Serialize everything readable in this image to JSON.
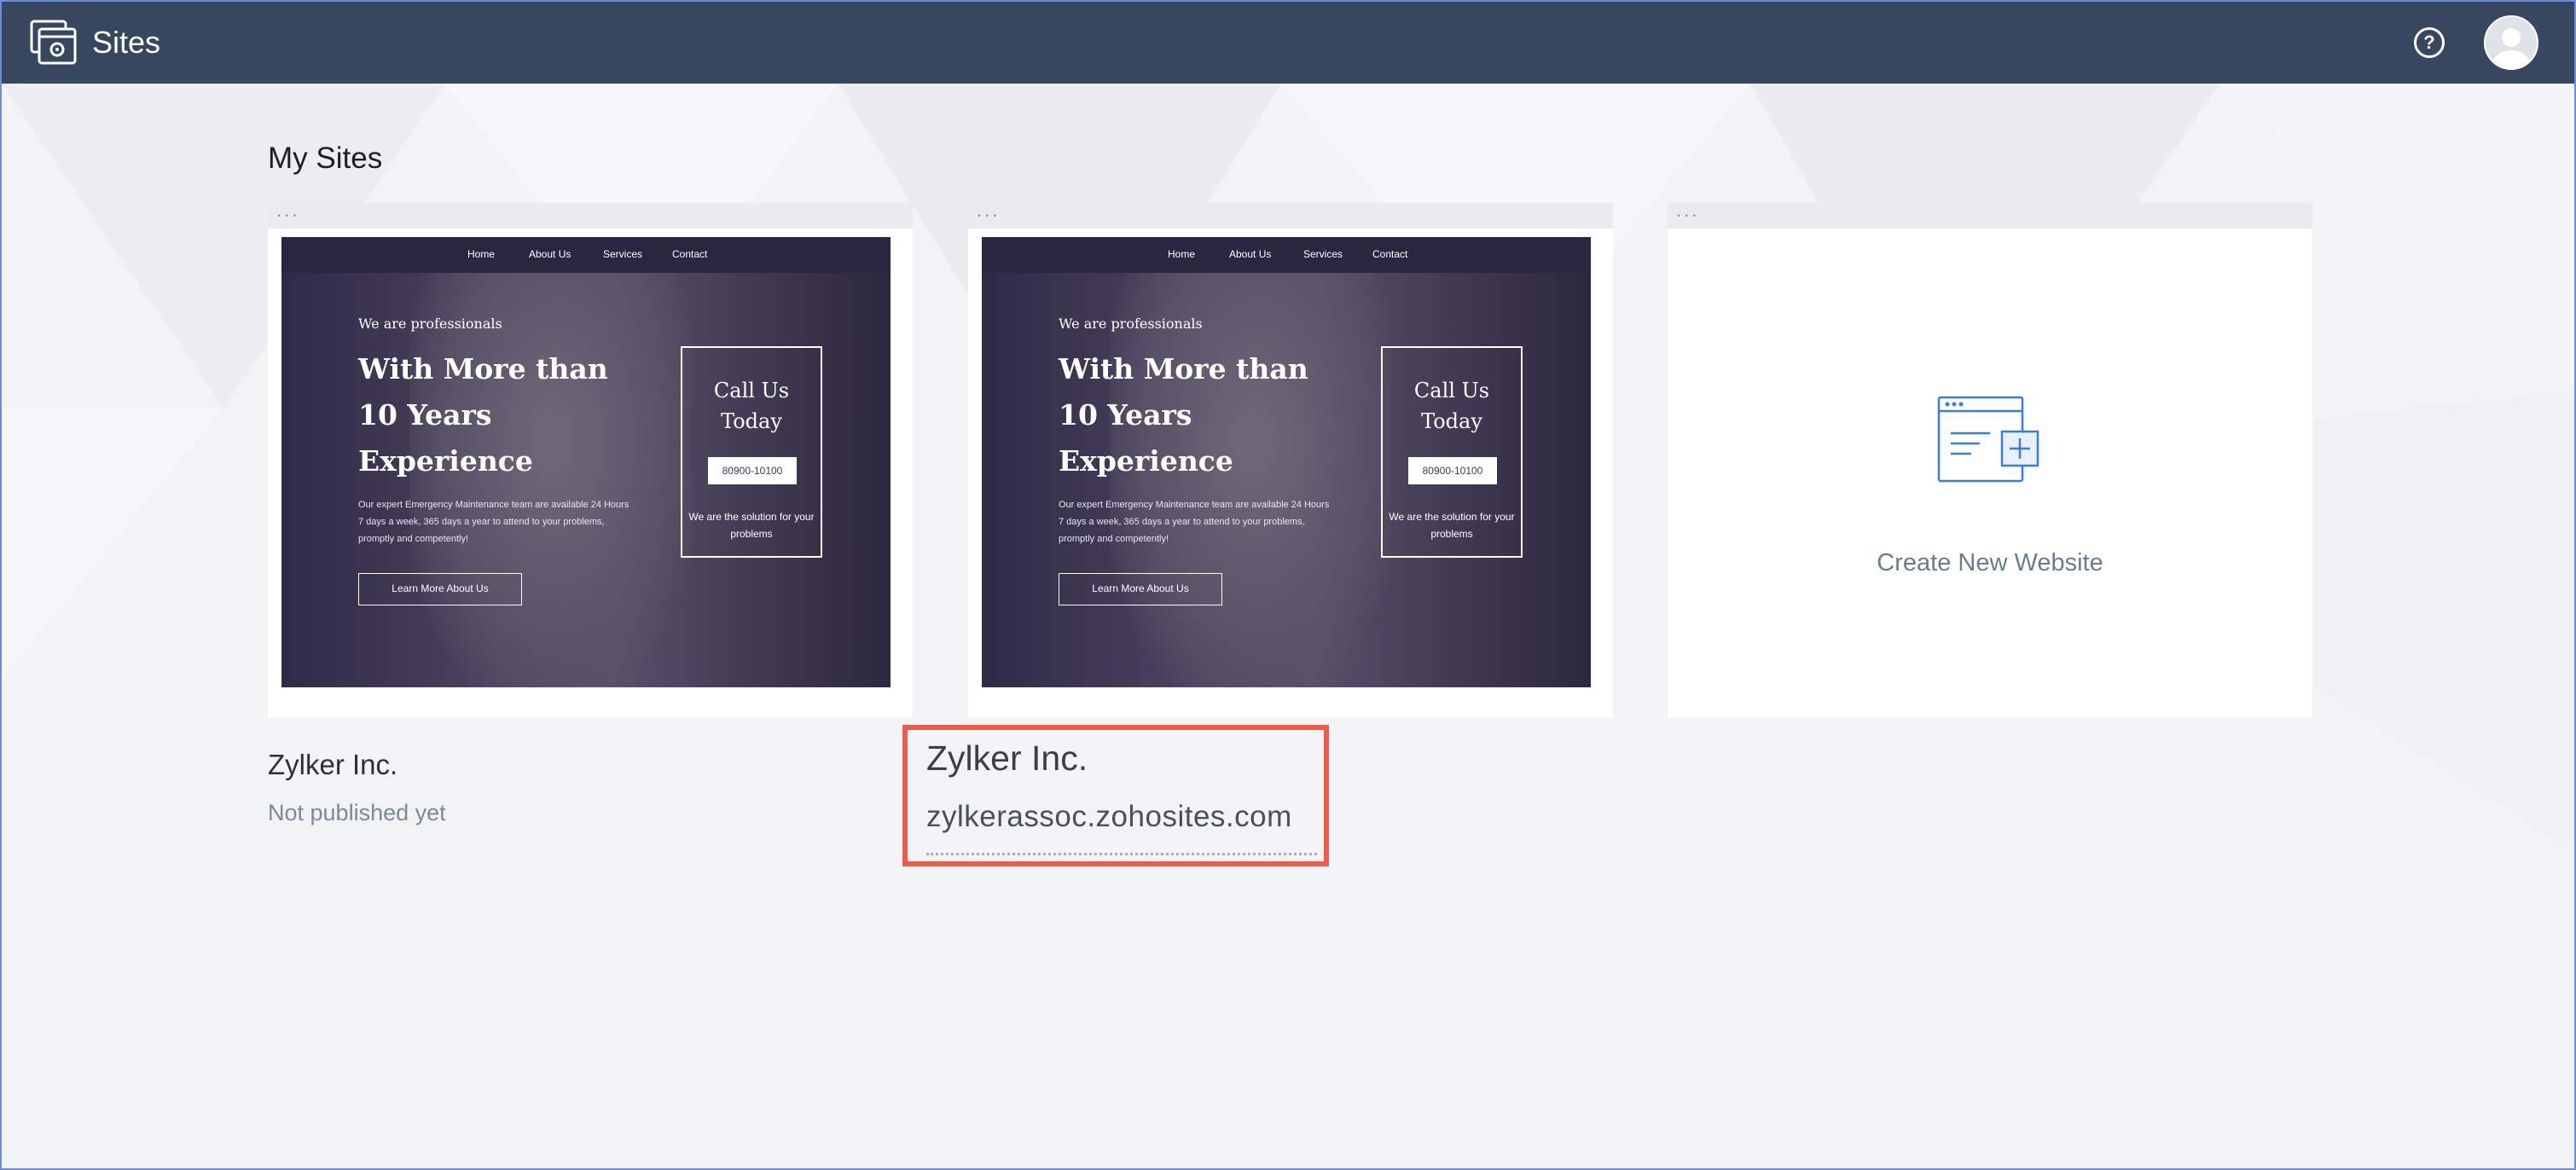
{
  "header": {
    "app_title": "Sites",
    "help_label": "?"
  },
  "main": {
    "section_title": "My Sites",
    "sites": [
      {
        "thumbnail": {
          "nav": [
            "Home",
            "About Us",
            "Services",
            "Contact"
          ],
          "kicker": "We are professionals",
          "headline": "With More than 10 Years Experience",
          "description": "Our expert Emergency Maintenance team are available 24 Hours 7 days a week, 365 days a year to attend to your problems, promptly and competently!",
          "button": "Learn More About Us",
          "call_title": "Call Us Today",
          "phone": "80900-10100",
          "solution": "We are the solution for your problems"
        },
        "name": "Zylker Inc.",
        "status": "Not published yet"
      },
      {
        "thumbnail": {
          "nav": [
            "Home",
            "About Us",
            "Services",
            "Contact"
          ],
          "kicker": "We are professionals",
          "headline": "With More than 10 Years Experience",
          "description": "Our expert Emergency Maintenance team are available 24 Hours 7 days a week, 365 days a year to attend to your problems, promptly and competently!",
          "button": "Learn More About Us",
          "call_title": "Call Us Today",
          "phone": "80900-10100",
          "solution": "We are the solution for your problems"
        },
        "name": "Zylker Inc.",
        "url": "zylkerassoc.zohosites.com"
      }
    ],
    "create_label": "Create New Website",
    "card_menu": "..."
  },
  "colors": {
    "topbar": "#37475f",
    "highlight": "#ef5b4c",
    "accent_icon": "#3b7ddd"
  }
}
